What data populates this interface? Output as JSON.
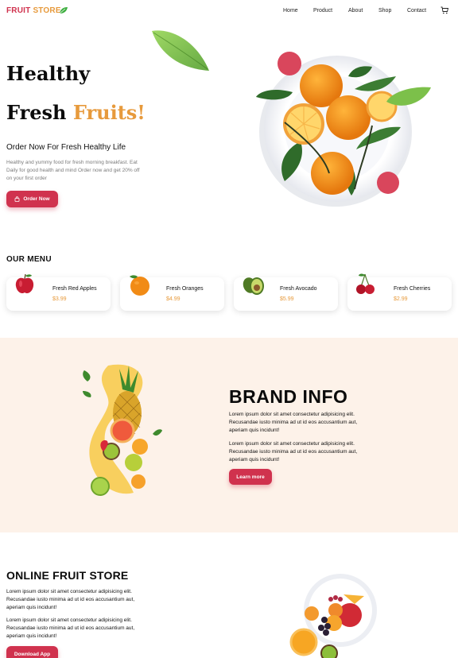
{
  "nav": {
    "logo_part1": "FRUIT",
    "logo_part2": "STORE",
    "items": [
      {
        "label": "Home"
      },
      {
        "label": "Product"
      },
      {
        "label": "About"
      },
      {
        "label": "Shop"
      },
      {
        "label": "Contact"
      }
    ]
  },
  "hero": {
    "line1": "Healthy",
    "line2_a": "Fresh",
    "line2_b": "Fruits!",
    "subtitle": "Order Now For Fresh Healthy Life",
    "description": "Healthy and yummy food for fresh morning breakfast. Eat Daily for good health and mind Order now and get 20% off on your first order",
    "order_button": "Order Now"
  },
  "our_menu": {
    "title": "OUR MENU",
    "items": [
      {
        "name": "Fresh Red Apples",
        "price": "$3.99"
      },
      {
        "name": "Fresh Oranges",
        "price": "$4.99"
      },
      {
        "name": "Fresh Avocado",
        "price": "$5.99"
      },
      {
        "name": "Fresh Cherries",
        "price": "$2.99"
      }
    ]
  },
  "brand": {
    "title": "BRAND INFO",
    "p1": "Lorem ipsum dolor sit amet consectetur adipisicing elit. Recusandae iusto minima ad ut id eos accusantium aut, aperiam quis incidunt!",
    "p2": "Lorem ipsum dolor sit amet consectetur adipisicing elit. Recusandae iusto minima ad ut id eos accusantium aut, aperiam quis incidunt!",
    "button": "Learn more"
  },
  "online": {
    "title": "ONLINE FRUIT STORE",
    "p1": "Lorem ipsum dolor sit amet consectetur adipisicing elit. Recusandae iusto minima ad ut id eos accusantium aut, aperiam quis incidunt!",
    "p2": "Lorem ipsum dolor sit amet consectetur adipisicing elit. Recusandae iusto minima ad ut id eos accusantium aut, aperiam quis incidunt!",
    "button": "Download App"
  },
  "colors": {
    "accent": "#d0324e",
    "orange": "#e79a3c",
    "brand_bg": "#fdf2e9"
  },
  "icons": [
    "leaf-icon",
    "cart-icon",
    "shopping-bag-icon"
  ]
}
